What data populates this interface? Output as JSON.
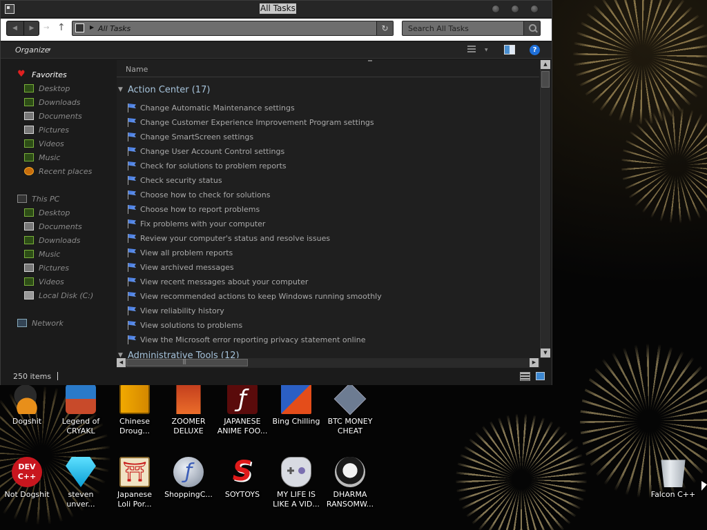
{
  "window": {
    "title": "All Tasks",
    "address_crumb": "All Tasks",
    "search_placeholder": "Search All Tasks",
    "organize_label": "Organize",
    "column_name": "Name",
    "status_count": "250 items"
  },
  "navpane": {
    "favorites": [
      {
        "label": "Favorites",
        "icon": "heart-icon"
      },
      {
        "label": "Desktop",
        "icon": "desktop-folder-icon"
      },
      {
        "label": "Downloads",
        "icon": "downloads-folder-icon"
      },
      {
        "label": "Documents",
        "icon": "documents-folder-icon"
      },
      {
        "label": "Pictures",
        "icon": "pictures-folder-icon"
      },
      {
        "label": "Videos",
        "icon": "videos-folder-icon"
      },
      {
        "label": "Music",
        "icon": "music-folder-icon"
      },
      {
        "label": "Recent places",
        "icon": "recent-places-icon"
      }
    ],
    "thispc": [
      {
        "label": "This PC",
        "icon": "computer-icon"
      },
      {
        "label": "Desktop",
        "icon": "desktop-folder-icon"
      },
      {
        "label": "Documents",
        "icon": "documents-folder-icon"
      },
      {
        "label": "Downloads",
        "icon": "downloads-folder-icon"
      },
      {
        "label": "Music",
        "icon": "music-folder-icon"
      },
      {
        "label": "Pictures",
        "icon": "pictures-folder-icon"
      },
      {
        "label": "Videos",
        "icon": "videos-folder-icon"
      },
      {
        "label": "Local Disk (C:)",
        "icon": "drive-icon"
      }
    ],
    "network": {
      "label": "Network",
      "icon": "network-icon"
    }
  },
  "groups": [
    {
      "name": "Action Center (17)",
      "tasks": [
        "Change Automatic Maintenance settings",
        "Change Customer Experience Improvement Program settings",
        "Change SmartScreen settings",
        "Change User Account Control settings",
        "Check for solutions to problem reports",
        "Check security status",
        "Choose how to check for solutions",
        "Choose how to report problems",
        "Fix problems with your computer",
        "Review your computer's status and resolve issues",
        "View all problem reports",
        "View archived messages",
        "View recent messages about your computer",
        "View recommended actions to keep Windows running smoothly",
        "View reliability history",
        "View solutions to problems",
        "View the Microsoft error reporting privacy statement online"
      ]
    },
    {
      "name": "Administrative Tools (12)",
      "tasks": []
    }
  ],
  "desktop_icons": [
    {
      "label": "Dogshit",
      "icon": "witch-icon"
    },
    {
      "label": "Legend of\nCRYAKL",
      "icon": "game-character-icon"
    },
    {
      "label": "Chinese\nDroug...",
      "icon": "book-icon"
    },
    {
      "label": "ZOOMER\nDELUXE",
      "icon": "zoomer-icon"
    },
    {
      "label": "JAPANESE\nANIME FOO...",
      "icon": "flash-dark-icon"
    },
    {
      "label": "Bing Chilling",
      "icon": "box-icon"
    },
    {
      "label": "BTC MONEY\nCHEAT",
      "icon": "diamond-icon"
    },
    {
      "label": "Not Dogshit",
      "icon": "dev-cpp-icon"
    },
    {
      "label": "steven\nunver...",
      "icon": "gem-icon"
    },
    {
      "label": "Japanese\nLoli Por...",
      "icon": "torii-icon"
    },
    {
      "label": "ShoppingC...",
      "icon": "flash-silver-icon"
    },
    {
      "label": "SOYTOYS",
      "icon": "soytoys-icon"
    },
    {
      "label": "MY LIFE IS\nLIKE A VID...",
      "icon": "gamepad-icon"
    },
    {
      "label": "DHARMA\nRANSOMW...",
      "icon": "skull-icon"
    },
    {
      "label": "Falcon C++",
      "icon": "recycle-bin-icon"
    }
  ],
  "dev_icon_text": "DEV\nC++"
}
